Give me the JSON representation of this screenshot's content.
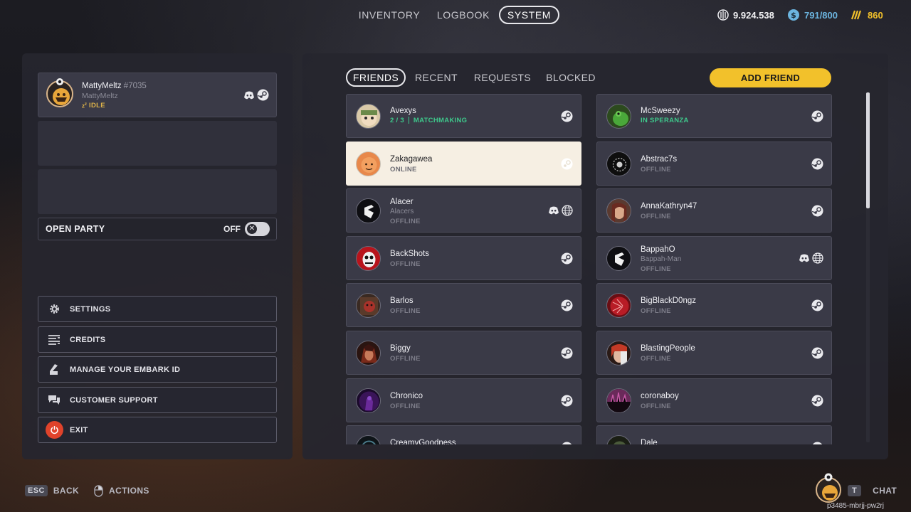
{
  "top_nav": {
    "tabs": [
      "INVENTORY",
      "LOGBOOK",
      "SYSTEM"
    ],
    "active_tab": "SYSTEM",
    "currency_1": "9.924.538",
    "currency_2": "791/800",
    "currency_3": "860",
    "accent_gold": "#f2c12b",
    "accent_blue": "#6cb5e0"
  },
  "profile": {
    "name": "MattyMeltz",
    "tag": "#7035",
    "alias": "MattyMeltz",
    "status": "IDLE",
    "platforms": [
      "discord-icon",
      "steam-icon"
    ]
  },
  "open_party": {
    "label": "OPEN PARTY",
    "state": "OFF"
  },
  "menu": [
    {
      "label": "SETTINGS",
      "icon": "gear-icon"
    },
    {
      "label": "CREDITS",
      "icon": "credits-list-icon"
    },
    {
      "label": "MANAGE YOUR EMBARK ID",
      "icon": "embark-id-icon"
    },
    {
      "label": "CUSTOMER SUPPORT",
      "icon": "support-chat-icon"
    },
    {
      "label": "EXIT",
      "icon": "power-icon"
    }
  ],
  "friends_panel": {
    "tabs": [
      "FRIENDS",
      "RECENT",
      "REQUESTS",
      "BLOCKED"
    ],
    "active_tab": "FRIENDS",
    "add_friend_label": "ADD FRIEND",
    "scroll_position": 0.0,
    "friends": [
      {
        "name": "Avexys",
        "status_prefix": "2 / 3",
        "status": "MATCHMAKING",
        "status_color": "green",
        "platforms": [
          "steam-icon"
        ]
      },
      {
        "name": "McSweezy",
        "status": "IN SPERANZA",
        "status_color": "green",
        "platforms": [
          "steam-icon"
        ]
      },
      {
        "name": "Zakagawea",
        "status": "ONLINE",
        "selected": true,
        "platforms": [
          "steam-icon"
        ]
      },
      {
        "name": "Abstrac7s",
        "status": "OFFLINE",
        "platforms": [
          "steam-icon"
        ]
      },
      {
        "name": "Alacer",
        "alias": "Alacers",
        "status": "OFFLINE",
        "platforms": [
          "discord-icon",
          "globe-icon"
        ]
      },
      {
        "name": "AnnaKathryn47",
        "status": "OFFLINE",
        "platforms": [
          "steam-icon"
        ]
      },
      {
        "name": "BackShots",
        "status": "OFFLINE",
        "platforms": [
          "steam-icon"
        ]
      },
      {
        "name": "BappahO",
        "alias": "Bappah-Man",
        "status": "OFFLINE",
        "platforms": [
          "discord-icon",
          "globe-icon"
        ]
      },
      {
        "name": "Barlos",
        "status": "OFFLINE",
        "platforms": [
          "steam-icon"
        ]
      },
      {
        "name": "BigBlackD0ngz",
        "status": "OFFLINE",
        "platforms": [
          "steam-icon"
        ]
      },
      {
        "name": "Biggy",
        "status": "OFFLINE",
        "platforms": [
          "steam-icon"
        ]
      },
      {
        "name": "BlastingPeople",
        "status": "OFFLINE",
        "platforms": [
          "steam-icon"
        ]
      },
      {
        "name": "Chronico",
        "status": "OFFLINE",
        "platforms": [
          "steam-icon"
        ]
      },
      {
        "name": "coronaboy",
        "status": "OFFLINE",
        "platforms": [
          "steam-icon"
        ]
      },
      {
        "name": "CreamyGoodness",
        "status": "",
        "platforms": [
          "steam-icon"
        ]
      },
      {
        "name": "Dale",
        "status": "",
        "platforms": [
          "steam-icon"
        ]
      }
    ]
  },
  "bottom_bar": {
    "back_key": "ESC",
    "back_label": "BACK",
    "actions_label": "ACTIONS",
    "chat_key": "T",
    "chat_label": "CHAT",
    "session_id": "p3485-mbrjj-pw2rj"
  }
}
